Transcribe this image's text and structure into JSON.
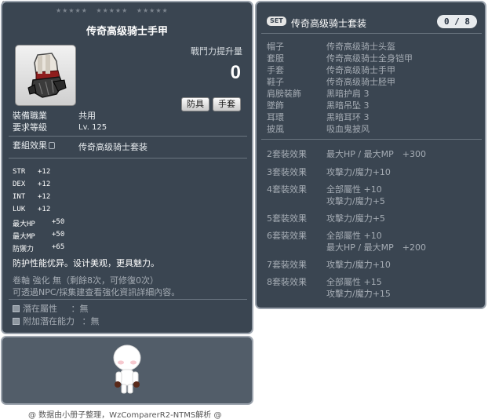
{
  "item_id": "01082460",
  "stars": [
    "★★★★★",
    "★★★★★",
    "★★★★★"
  ],
  "item": {
    "title": "传奇高级骑士手甲",
    "power_label": "戰鬥力提升量",
    "power_value": "0",
    "tags": [
      "防具",
      "手套"
    ],
    "job_label": "裝備職業",
    "job_value": "共用",
    "level_label": "要求等級",
    "level_value": "Lv. 125",
    "set_effect_label": "套組效果",
    "set_effect_value": "传奇高级骑士套装",
    "stats": [
      {
        "name": "STR",
        "value": "+12"
      },
      {
        "name": "DEX",
        "value": "+12"
      },
      {
        "name": "INT",
        "value": "+12"
      },
      {
        "name": "LUK",
        "value": "+12"
      },
      {
        "name": "最大HP",
        "value": "+50"
      },
      {
        "name": "最大MP",
        "value": "+50"
      },
      {
        "name": "防禦力",
        "value": "+65"
      }
    ],
    "description": "防护性能优异。设计美观，更具魅力。",
    "scroll_info": "卷軸 強化 無（剩餘8次，可修復0次）",
    "npc_info": "可透過NPC/採集建查看強化資訊詳細內容。",
    "potential_label": "潛在屬性",
    "potential_value": "：無",
    "bonus_potential_label": "附加潛在能力",
    "bonus_potential_value": "：無",
    "glove_color": "#8f1d1d"
  },
  "set": {
    "badge": "SET",
    "title": "传奇高级骑士套装",
    "count": "0 / 8",
    "parts": [
      {
        "slot": "帽子",
        "name": "传奇高级骑士头盔"
      },
      {
        "slot": "套服",
        "name": "传奇高级骑士全身铠甲"
      },
      {
        "slot": "手套",
        "name": "传奇高级骑士手甲"
      },
      {
        "slot": "鞋子",
        "name": "传奇高级骑士胫甲"
      },
      {
        "slot": "肩膀裝飾",
        "name": "黑暗护肩 3"
      },
      {
        "slot": "墜飾",
        "name": "黑暗吊坠 3"
      },
      {
        "slot": "耳環",
        "name": "黑暗耳环 3"
      },
      {
        "slot": "披風",
        "name": "吸血鬼披风"
      }
    ],
    "effects": [
      {
        "head": "2套裝效果",
        "lines": [
          "最大HP / 最大MP　+300"
        ]
      },
      {
        "head": "3套裝效果",
        "lines": [
          "攻擊力/魔力+10"
        ]
      },
      {
        "head": "4套裝效果",
        "lines": [
          "全部屬性 +10",
          "攻擊力/魔力+5"
        ]
      },
      {
        "head": "5套裝效果",
        "lines": [
          "攻擊力/魔力+5"
        ]
      },
      {
        "head": "6套裝效果",
        "lines": [
          "全部屬性 +10",
          "最大HP / 最大MP　+200"
        ]
      },
      {
        "head": "7套裝效果",
        "lines": [
          "攻擊力/魔力+10"
        ]
      },
      {
        "head": "8套裝效果",
        "lines": [
          "全部屬性 +15",
          "攻擊力/魔力+15"
        ]
      }
    ]
  },
  "footer": "@ 数据由小册子整理，WzComparerR2-NTMS解析 @"
}
